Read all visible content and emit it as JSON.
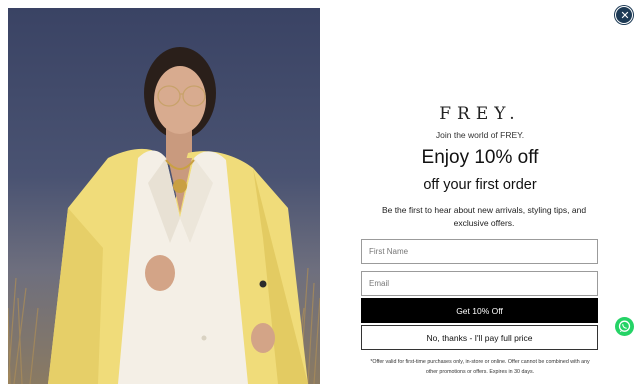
{
  "popup": {
    "brand": "FREY.",
    "tagline": "Join the world of FREY.",
    "headline": "Enjoy 10% off",
    "subheadline": "off your first order",
    "description": "Be the first to hear about new arrivals, styling tips, and exclusive offers.",
    "first_name_placeholder": "First Name",
    "email_placeholder": "Email",
    "submit_label": "Get 10% Off",
    "decline_label": "No, thanks - I'll pay full price",
    "disclaimer": "*Offer valid for first-time purchases only, in-store or online. Offer cannot be combined with any other promotions or offers. Expires in 30 days."
  },
  "icons": {
    "close": "close-icon",
    "chat": "whatsapp-icon"
  },
  "colors": {
    "close_button": "#1d3a55",
    "primary_button": "#000000",
    "whatsapp": "#25d366",
    "jacket": "#f0dc7a"
  }
}
